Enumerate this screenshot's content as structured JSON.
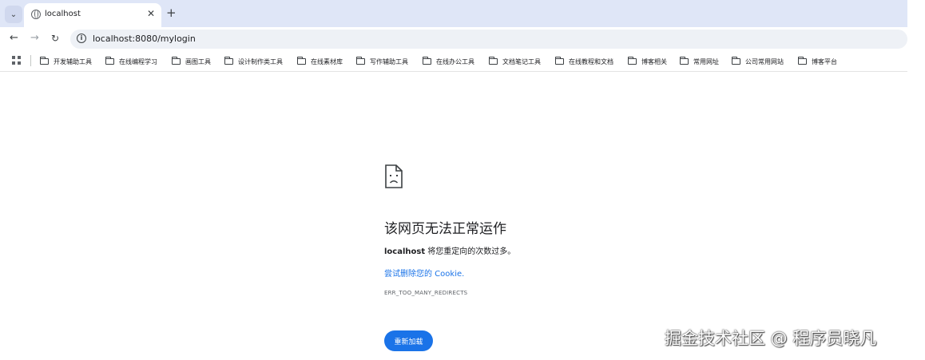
{
  "browser": {
    "tab": {
      "title": "localhost",
      "close_glyph": "✕"
    },
    "new_tab_glyph": "+",
    "tab_search_glyph": "⌄",
    "nav": {
      "back": "←",
      "forward": "→",
      "reload": "↻"
    },
    "site_info_glyph": "i",
    "url": "localhost:8080/mylogin",
    "bookmarks": [
      "开发辅助工具",
      "在线编程学习",
      "画图工具",
      "设计制作类工具",
      "在线素材库",
      "写作辅助工具",
      "在线办公工具",
      "文档笔记工具",
      "在线教程和文档",
      "博客相关",
      "常用网址",
      "公司常用网站",
      "博客平台"
    ]
  },
  "error_page": {
    "title": "该网页无法正常运作",
    "host": "localhost",
    "description": " 将您重定向的次数过多。",
    "link_text": "尝试删除您的 Cookie.",
    "error_code": "ERR_TOO_MANY_REDIRECTS",
    "reload_label": "重新加载"
  },
  "watermark": "掘金技术社区 @ 程序员晓凡",
  "colors": {
    "accent": "#1a73e8",
    "tabstrip": "#dfe6f7",
    "omnibox": "#eef1f6"
  },
  "icons": {
    "tab_favicon": "globe-icon",
    "site_info": "info-icon",
    "apps": "apps-grid-icon",
    "bookmark": "folder-icon",
    "error": "sad-page-icon"
  }
}
